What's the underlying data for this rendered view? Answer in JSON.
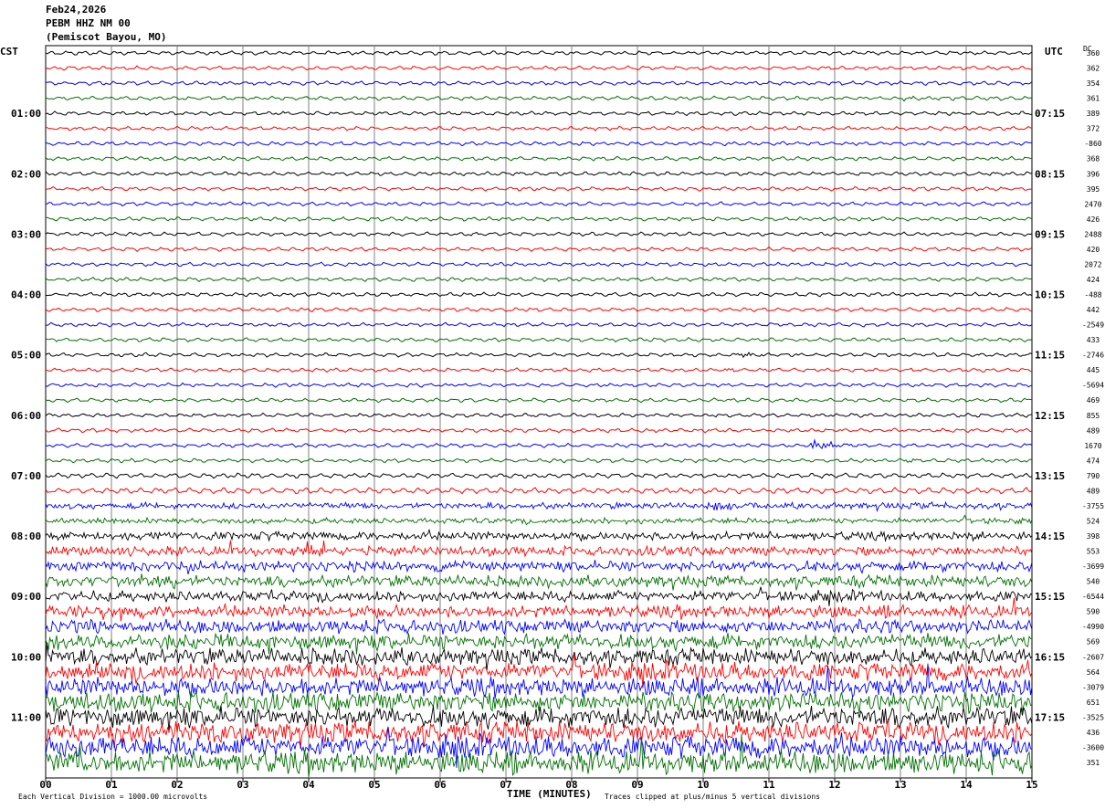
{
  "header": {
    "date": "Feb24,2026",
    "station": "PEBM HHZ NM 00",
    "location": "(Pemiscot Bayou, MO)"
  },
  "left_timezone": "CST",
  "right_timezone": "UTC",
  "dc_label": "DC",
  "footer": {
    "x_title": "TIME (MINUTES)",
    "scale_note": "Each Vertical Division = 1000.00 microvolts",
    "clip_note": "Traces clipped at plus/minus 5 vertical divisions"
  },
  "colors": {
    "trace_cycle": [
      "#000000",
      "#ff0000",
      "#0000ff",
      "#007000"
    ],
    "grid": "#808080"
  },
  "chart_data": {
    "type": "helicorder",
    "x_ticks": [
      "00",
      "01",
      "02",
      "03",
      "04",
      "05",
      "06",
      "07",
      "08",
      "09",
      "10",
      "11",
      "12",
      "13",
      "14",
      "15"
    ],
    "xlim": [
      0,
      15
    ],
    "minutes_per_line": 15,
    "line_count": 48,
    "left_hour_labels": [
      "01:00",
      "02:00",
      "03:00",
      "04:00",
      "05:00",
      "06:00",
      "07:00",
      "08:00",
      "09:00",
      "10:00",
      "11:00"
    ],
    "right_hour_labels": [
      "07:15",
      "08:15",
      "09:15",
      "10:15",
      "11:15",
      "12:15",
      "13:15",
      "14:15",
      "15:15",
      "16:15",
      "17:15"
    ],
    "dc_values": [
      "360",
      "362",
      "354",
      "361",
      "389",
      "372",
      "-860",
      "368",
      "396",
      "395",
      "2470",
      "426",
      "2488",
      "420",
      "2072",
      "424",
      "-488",
      "442",
      "-2549",
      "433",
      "-2746",
      "445",
      "-5694",
      "469",
      "855",
      "489",
      "1670",
      "474",
      "790",
      "489",
      "-3755",
      "524",
      "398",
      "553",
      "-3699",
      "540",
      "-6544",
      "590",
      "-4990",
      "569",
      "-2607",
      "564",
      "-3079",
      "651",
      "-3525",
      "436",
      "-3600",
      "351"
    ],
    "noise_level": [
      1,
      1,
      1,
      1,
      1,
      1,
      1,
      1,
      1,
      1,
      1,
      1,
      1,
      1,
      1,
      1,
      1,
      1,
      1,
      1,
      1,
      1,
      1,
      1,
      1,
      1,
      1,
      1,
      1.3,
      1.6,
      3,
      2.6,
      4,
      4.5,
      5,
      5.5,
      5,
      6,
      6.5,
      7.5,
      8,
      8.5,
      9,
      9.5,
      10,
      10,
      10.5,
      11
    ],
    "events": [
      {
        "line": 3,
        "minute": 13.0,
        "amplitude": 2
      },
      {
        "line": 20,
        "minute": 10.5,
        "amplitude": 4
      },
      {
        "line": 21,
        "minute": 10.3,
        "amplitude": 2
      },
      {
        "line": 26,
        "minute": 11.7,
        "amplitude": 9
      },
      {
        "line": 27,
        "minute": 13.0,
        "amplitude": 2
      },
      {
        "line": 30,
        "minute": 10.2,
        "amplitude": 6
      },
      {
        "line": 33,
        "minute": 4.0,
        "amplitude": 6
      }
    ]
  }
}
